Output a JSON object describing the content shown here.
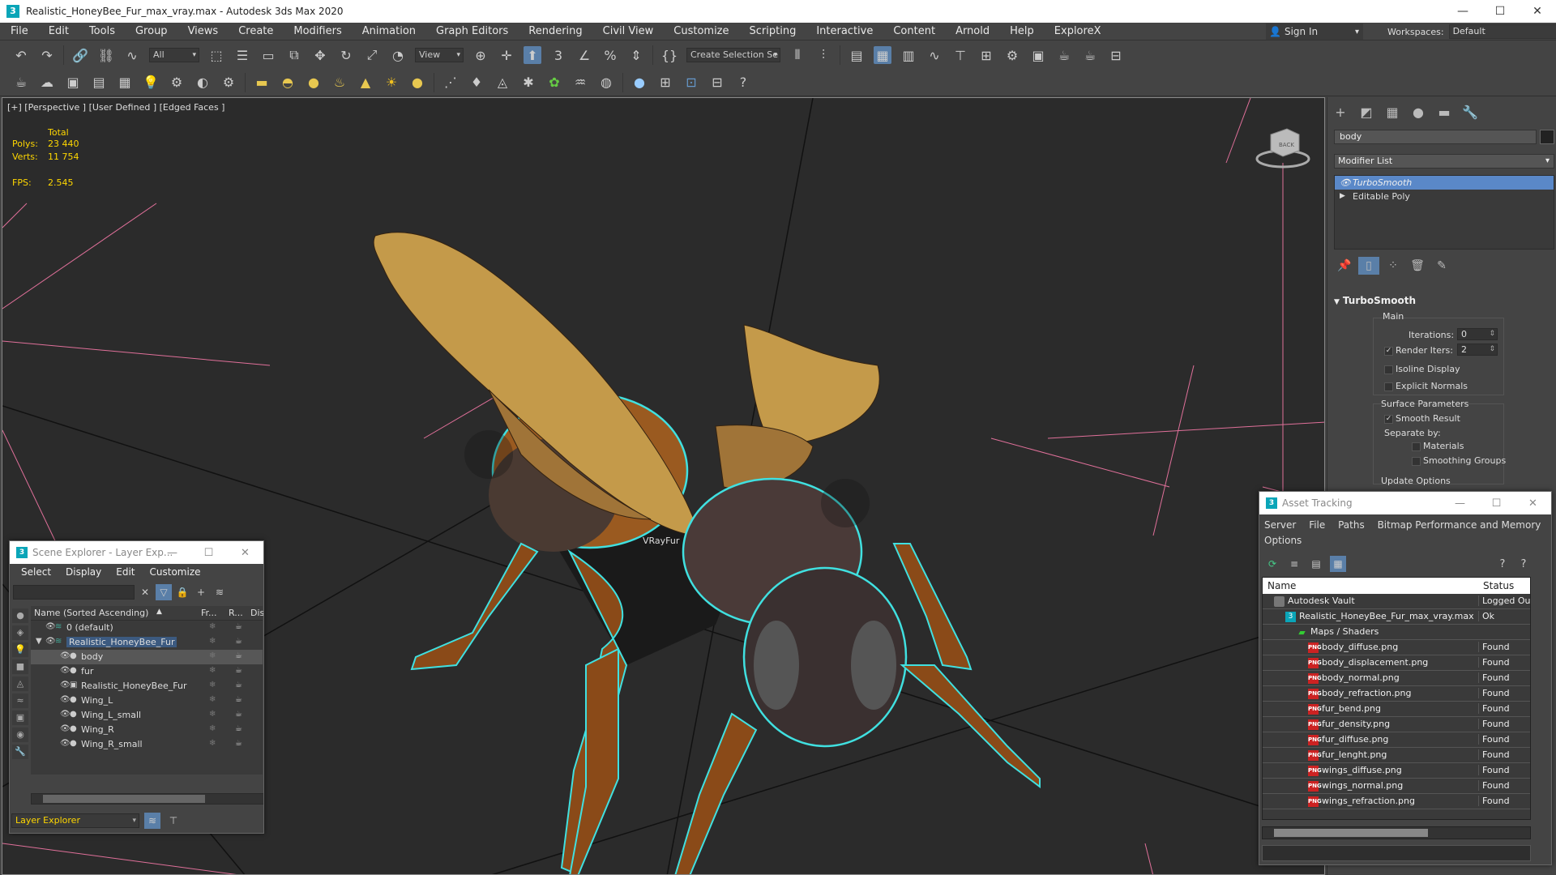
{
  "window": {
    "title": "Realistic_HoneyBee_Fur_max_vray.max - Autodesk 3ds Max 2020",
    "minimize": "—",
    "maximize": "☐",
    "close": "✕"
  },
  "menu": {
    "items": [
      "File",
      "Edit",
      "Tools",
      "Group",
      "Views",
      "Create",
      "Modifiers",
      "Animation",
      "Graph Editors",
      "Rendering",
      "Civil View",
      "Customize",
      "Scripting",
      "Interactive",
      "Content",
      "Arnold",
      "Help",
      "ExploreX"
    ],
    "sign_in": "Sign In",
    "workspaces_label": "Workspaces:",
    "workspaces_value": "Default"
  },
  "toolbar": {
    "selection_filter": "All",
    "ref_coord": "View",
    "named_selection": "Create Selection Se"
  },
  "viewport": {
    "label": "[+] [Perspective ] [User Defined ] [Edged Faces ]",
    "stats_total": "Total",
    "polys_label": "Polys:",
    "polys_value": "23 440",
    "verts_label": "Verts:",
    "verts_value": "11 754",
    "fps_label": "FPS:",
    "fps_value": "2.545",
    "vray_label": "VRayFur",
    "cube_face": "BACK"
  },
  "command_panel": {
    "object_name": "body",
    "modifier_list": "Modifier List",
    "stack": [
      {
        "label": "TurboSmooth",
        "selected": true
      },
      {
        "label": "Editable Poly",
        "selected": false
      }
    ],
    "rollout": "TurboSmooth",
    "main_group": "Main",
    "iterations_label": "Iterations:",
    "iterations_value": "0",
    "render_iters_label": "Render Iters:",
    "render_iters_value": "2",
    "isoline_label": "Isoline Display",
    "explicit_normals_label": "Explicit Normals",
    "surface_group": "Surface Parameters",
    "smooth_result_label": "Smooth Result",
    "separate_by_label": "Separate by:",
    "materials_label": "Materials",
    "smoothing_groups_label": "Smoothing Groups",
    "update_options": "Update Options"
  },
  "scene_explorer": {
    "title": "Scene Explorer - Layer Exp...",
    "menu": [
      "Select",
      "Display",
      "Edit",
      "Customize"
    ],
    "columns": {
      "name": "Name (Sorted Ascending)",
      "frozen": "Fr...",
      "render": "R...",
      "display": "Disp"
    },
    "rows": [
      {
        "name": "0 (default)",
        "level": 0
      },
      {
        "name": "Realistic_HoneyBee_Fur",
        "level": 0
      },
      {
        "name": "body",
        "level": 1
      },
      {
        "name": "fur",
        "level": 1
      },
      {
        "name": "Realistic_HoneyBee_Fur",
        "level": 1
      },
      {
        "name": "Wing_L",
        "level": 1
      },
      {
        "name": "Wing_L_small",
        "level": 1
      },
      {
        "name": "Wing_R",
        "level": 1
      },
      {
        "name": "Wing_R_small",
        "level": 1
      }
    ],
    "bottom_dropdown": "Layer Explorer"
  },
  "asset_tracking": {
    "title": "Asset Tracking",
    "menu": [
      "Server",
      "File",
      "Paths",
      "Bitmap Performance and Memory",
      "Options"
    ],
    "columns": {
      "name": "Name",
      "status": "Status"
    },
    "rows": [
      {
        "name": "Autodesk Vault",
        "status": "Logged Ou",
        "icon": "vault",
        "indent": 0
      },
      {
        "name": "Realistic_HoneyBee_Fur_max_vray.max",
        "status": "Ok",
        "icon": "max",
        "indent": 1
      },
      {
        "name": "Maps / Shaders",
        "status": "",
        "icon": "maps",
        "indent": 2
      },
      {
        "name": "body_diffuse.png",
        "status": "Found",
        "icon": "png",
        "indent": 3
      },
      {
        "name": "body_displacement.png",
        "status": "Found",
        "icon": "png",
        "indent": 3
      },
      {
        "name": "body_normal.png",
        "status": "Found",
        "icon": "png",
        "indent": 3
      },
      {
        "name": "body_refraction.png",
        "status": "Found",
        "icon": "png",
        "indent": 3
      },
      {
        "name": "fur_bend.png",
        "status": "Found",
        "icon": "png",
        "indent": 3
      },
      {
        "name": "fur_density.png",
        "status": "Found",
        "icon": "png",
        "indent": 3
      },
      {
        "name": "fur_diffuse.png",
        "status": "Found",
        "icon": "png",
        "indent": 3
      },
      {
        "name": "fur_lenght.png",
        "status": "Found",
        "icon": "png",
        "indent": 3
      },
      {
        "name": "wings_diffuse.png",
        "status": "Found",
        "icon": "png",
        "indent": 3
      },
      {
        "name": "wings_normal.png",
        "status": "Found",
        "icon": "png",
        "indent": 3
      },
      {
        "name": "wings_refraction.png",
        "status": "Found",
        "icon": "png",
        "indent": 3
      }
    ]
  },
  "colors": {
    "selection_outline": "#40e0e0",
    "grid_line": "#e0709a",
    "stat_text": "#ffd700",
    "accent_blue": "#5a88c8"
  }
}
